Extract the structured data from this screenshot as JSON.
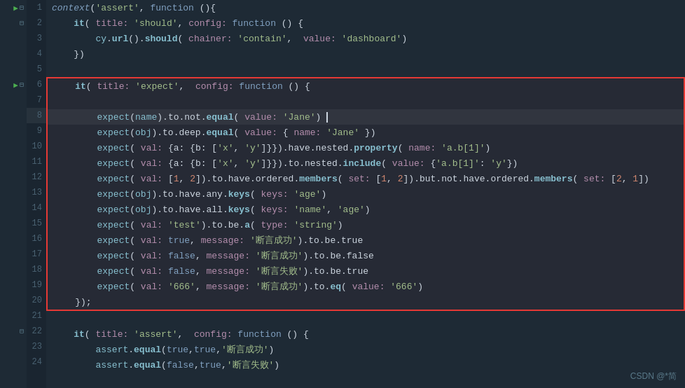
{
  "editor": {
    "lines": [
      {
        "num": 1,
        "hasArrow": true,
        "hasCollapse": true,
        "indent": 0,
        "content": "context_line_1"
      },
      {
        "num": 2,
        "hasArrow": false,
        "hasCollapse": true,
        "indent": 1,
        "content": "it_line_2"
      },
      {
        "num": 3,
        "hasArrow": false,
        "hasCollapse": false,
        "indent": 2,
        "content": "cy_line_3"
      },
      {
        "num": 4,
        "hasArrow": false,
        "hasCollapse": false,
        "indent": 1,
        "content": "close_bracket_4"
      },
      {
        "num": 5,
        "hasArrow": false,
        "hasCollapse": false,
        "indent": 0,
        "content": "empty_5"
      },
      {
        "num": 6,
        "hasArrow": true,
        "hasCollapse": true,
        "indent": 1,
        "content": "it_expect_6",
        "highlighted": true
      },
      {
        "num": 7,
        "hasArrow": false,
        "hasCollapse": false,
        "indent": 0,
        "content": "empty_7",
        "highlighted": true
      },
      {
        "num": 8,
        "hasArrow": false,
        "hasCollapse": false,
        "indent": 2,
        "content": "expect_notequal_8",
        "highlighted": true,
        "current": true
      },
      {
        "num": 9,
        "hasArrow": false,
        "hasCollapse": false,
        "indent": 2,
        "content": "expect_deepequal_9",
        "highlighted": true
      },
      {
        "num": 10,
        "hasArrow": false,
        "hasCollapse": false,
        "indent": 2,
        "content": "expect_nested_prop_10",
        "highlighted": true
      },
      {
        "num": 11,
        "hasArrow": false,
        "hasCollapse": false,
        "indent": 2,
        "content": "expect_nested_include_11",
        "highlighted": true
      },
      {
        "num": 12,
        "hasArrow": false,
        "hasCollapse": false,
        "indent": 2,
        "content": "expect_ordered_12",
        "highlighted": true
      },
      {
        "num": 13,
        "hasArrow": false,
        "hasCollapse": false,
        "indent": 2,
        "content": "expect_any_keys_13",
        "highlighted": true
      },
      {
        "num": 14,
        "hasArrow": false,
        "hasCollapse": false,
        "indent": 2,
        "content": "expect_all_keys_14",
        "highlighted": true
      },
      {
        "num": 15,
        "hasArrow": false,
        "hasCollapse": false,
        "indent": 2,
        "content": "expect_bea_15",
        "highlighted": true
      },
      {
        "num": 16,
        "hasArrow": false,
        "hasCollapse": false,
        "indent": 2,
        "content": "expect_true_16",
        "highlighted": true
      },
      {
        "num": 17,
        "hasArrow": false,
        "hasCollapse": false,
        "indent": 2,
        "content": "expect_false_17",
        "highlighted": true
      },
      {
        "num": 18,
        "hasArrow": false,
        "hasCollapse": false,
        "indent": 2,
        "content": "expect_false_true_18",
        "highlighted": true
      },
      {
        "num": 19,
        "hasArrow": false,
        "hasCollapse": false,
        "indent": 2,
        "content": "expect_eq_19",
        "highlighted": true
      },
      {
        "num": 20,
        "hasArrow": false,
        "hasCollapse": false,
        "indent": 1,
        "content": "close_bracket_semi_20",
        "highlighted": true
      },
      {
        "num": 21,
        "hasArrow": false,
        "hasCollapse": false,
        "indent": 0,
        "content": "empty_21"
      },
      {
        "num": 22,
        "hasArrow": false,
        "hasCollapse": true,
        "indent": 1,
        "content": "it_assert_22"
      },
      {
        "num": 23,
        "hasArrow": false,
        "hasCollapse": false,
        "indent": 2,
        "content": "assert_equal_true_23"
      },
      {
        "num": 24,
        "hasArrow": false,
        "hasCollapse": false,
        "indent": 2,
        "content": "assert_equal_false_24"
      }
    ]
  },
  "watermark": "CSDN @*简"
}
